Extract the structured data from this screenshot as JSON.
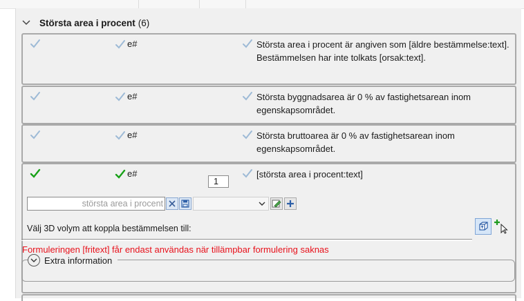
{
  "section": {
    "title": "Största area i procent",
    "count": "(6)"
  },
  "col2_label": "e#",
  "rows": [
    {
      "text": "Största area i procent är angiven som [äldre bestämmelse:text]. Bestämmelsen har inte tolkats [orsak:text]."
    },
    {
      "text": "Största byggnadsarea är 0 % av fastighetsarean inom egenskapsområdet."
    },
    {
      "text": "Största bruttoarea är 0 % av fastighetsarean inom egenskapsområdet."
    }
  ],
  "active_row": {
    "index_value": "1",
    "text": "[största area i procent:text]",
    "search_placeholder": "största area i procent",
    "volume_label": "Välj 3D volym att koppla bestämmelsen till:",
    "warning": "Formuleringen [fritext] får endast användas när tillämpbar formulering saknas",
    "extra_label": "Extra information"
  },
  "colors": {
    "check_green": "#17a117",
    "check_gray": "#9dbad6",
    "warning_red": "#e8111b"
  },
  "icons": [
    "chevron-down-icon",
    "check-icon",
    "clear-icon",
    "save-icon",
    "edit-icon",
    "add-icon",
    "volume-icon",
    "add-cursor-icon",
    "circle-chevron-down-icon"
  ]
}
